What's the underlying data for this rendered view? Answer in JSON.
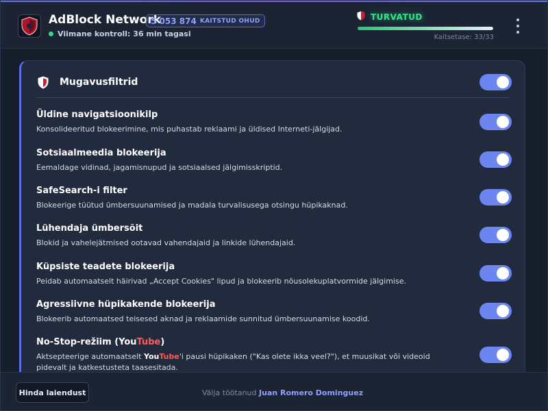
{
  "header": {
    "app_title": "AdBlock Network",
    "threat_count": "5 053 874",
    "threat_label": "KAITSTUD OHUD",
    "last_check": "Viimane kontroll: 36 min tagasi",
    "status": "TURVATUD",
    "protection_label": "Kaitsetase: 33/33",
    "protection_progress": 1.0
  },
  "card": {
    "title": "Mugavusfiltrid",
    "master_toggle_on": true,
    "items": [
      {
        "title": "Üldine navigatsioonikilp",
        "desc": "Konsolideeritud blokeerimine, mis puhastab reklaami ja üldised Interneti-jälgijad.",
        "enabled": true
      },
      {
        "title": "Sotsiaalmeedia blokeerija",
        "desc": "Eemaldage vidinad, jagamisnupud ja sotsiaalsed jälgimisskriptid.",
        "enabled": true
      },
      {
        "title": "SafeSearch-i filter",
        "desc": "Blokeerige tüütud ümbersuunamised ja madala turvalisusega otsingu hüpikaknad.",
        "enabled": true
      },
      {
        "title": "Lühendaja ümbersõit",
        "desc": "Blokid ja vahelejätmised ootavad vahendajaid ja linkide lühendajaid.",
        "enabled": true
      },
      {
        "title": "Küpsiste teadete blokeerija",
        "desc": "Peidab automaatselt häirivad „Accept Cookies\" lipud ja blokeerib nõusolekuplatvormide jälgimise.",
        "enabled": true
      },
      {
        "title": "Agressiivne hüpikakende blokeerija",
        "desc": "Blokeerib automaatsed teisesed aknad ja reklaamide sunnitud ümbersuunamise koodid.",
        "enabled": true
      }
    ],
    "nostop": {
      "title_prefix": "No-Stop-režiim (",
      "title_you": "You",
      "title_tube": "Tube",
      "title_suffix": ")",
      "desc_prefix": "Aktsepteerige automaatselt ",
      "desc_you": "You",
      "desc_tube": "Tube",
      "desc_suffix": "'i pausi hüpikaken (\"Kas olete ikka veel?\"), et muusikat või videoid pidevalt ja katkestusteta taasesitada.",
      "enabled": true
    }
  },
  "footer": {
    "rate_button": "Hinda laiendust",
    "credit_prefix": "Välja töötanud ",
    "credit_author": "Juan Romero Dominguez"
  },
  "colors": {
    "accent": "#6c85ef",
    "status_green": "#34e38a",
    "youtube_red": "#ff5a5a"
  },
  "icons": {
    "logo": "adblock-shield-logo",
    "status": "shield-icon",
    "card_header": "shield-icon",
    "menu": "kebab-menu-icon"
  }
}
